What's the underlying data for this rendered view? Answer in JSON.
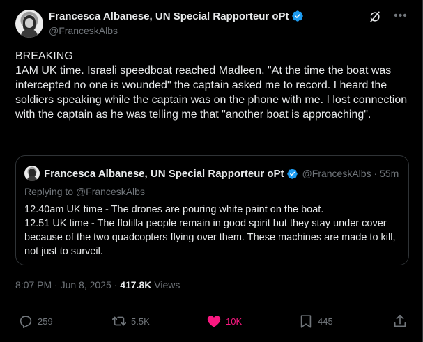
{
  "author": {
    "display_name": "Francesca Albanese, UN Special Rapporteur oPt",
    "handle": "@FranceskAlbs"
  },
  "tweet": {
    "text": "BREAKING\n1AM UK time. Israeli speedboat reached Madleen. \"At the time the boat was intercepted no one is wounded\" the captain asked me to record. I heard the soldiers speaking while the captain was on the phone with me. I lost connection with the captain as he was telling me that \"another boat is approaching\"."
  },
  "quote": {
    "display_name": "Francesca Albanese, UN Special Rapporteur oPt",
    "meta": "@FranceskAlbs · 55m",
    "replying_to": "Replying to @FranceskAlbs",
    "text": "12.40am UK time - The drones are pouring white paint on the boat.\n12.51 UK time - The flotilla people remain in good spirit but they stay under cover because of the two quadcopters flying over them. These machines are made to kill, not just to surveil."
  },
  "meta": {
    "timestamp": "8:07 PM · Jun 8, 2025 · ",
    "views_count": "417.8K",
    "views_label": " Views"
  },
  "actions": {
    "replies": "259",
    "reposts": "5.5K",
    "likes": "10K",
    "bookmarks": "445"
  },
  "colors": {
    "background": "#000000",
    "verified": "#1d9bf0",
    "like_active": "#f91880",
    "secondary_text": "#71767b"
  },
  "icons": {
    "verified": "verified-badge-icon",
    "grok": "grok-icon",
    "more": "more-dots-icon",
    "reply": "reply-icon",
    "repost": "repost-icon",
    "like": "heart-filled-icon",
    "bookmark": "bookmark-icon",
    "share": "share-icon"
  }
}
